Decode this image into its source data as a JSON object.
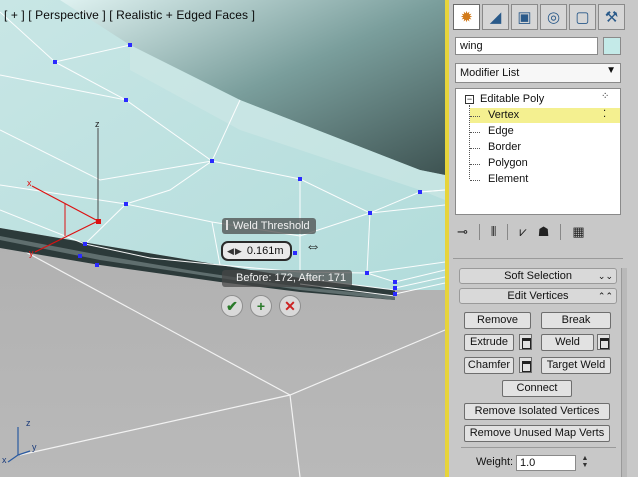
{
  "viewport": {
    "label": "[ + ] [ Perspective ] [ Realistic + Edged Faces ]",
    "axis_labels": {
      "x": "x",
      "y": "y",
      "z": "z"
    }
  },
  "caddy": {
    "title": "Weld Threshold",
    "value": "0.161m",
    "info": "Before: 172, After: 171",
    "ok_icon": "checkmark-icon",
    "apply_icon": "plus-icon",
    "cancel_icon": "cancel-icon"
  },
  "panel": {
    "tabs": [
      "create-icon",
      "modify-icon",
      "hierarchy-icon",
      "motion-icon",
      "display-icon",
      "utilities-icon"
    ],
    "object_name": "wing",
    "object_color": "#c4eae8",
    "modifier_list": "Modifier List",
    "stack": {
      "root": "Editable Poly",
      "items": [
        "Vertex",
        "Edge",
        "Border",
        "Polygon",
        "Element"
      ],
      "selected": "Vertex"
    },
    "soft_selection": "Soft Selection",
    "edit_vertices": {
      "title": "Edit Vertices",
      "remove": "Remove",
      "break": "Break",
      "extrude": "Extrude",
      "weld": "Weld",
      "chamfer": "Chamfer",
      "target_weld": "Target Weld",
      "connect": "Connect",
      "remove_isolated": "Remove Isolated Vertices",
      "remove_unused": "Remove Unused Map Verts",
      "weight_label": "Weight:",
      "weight_value": "1.0"
    }
  },
  "colors": {
    "selection_accent": "#e7d43a",
    "mesh_face": "#bfe2e1",
    "vertex": "#2a2aff"
  }
}
